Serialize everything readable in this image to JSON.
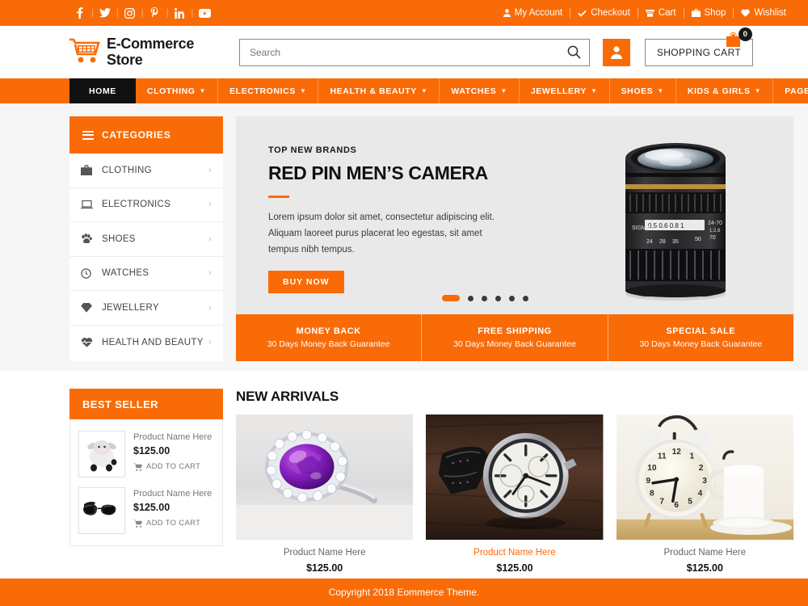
{
  "topbar": {
    "social": [
      {
        "name": "facebook-icon",
        "label": "Facebook"
      },
      {
        "name": "twitter-icon",
        "label": "Twitter"
      },
      {
        "name": "instagram-icon",
        "label": "Instagram"
      },
      {
        "name": "pinterest-icon",
        "label": "Pinterest"
      },
      {
        "name": "linkedin-icon",
        "label": "LinkedIn"
      },
      {
        "name": "youtube-icon",
        "label": "YouTube"
      }
    ],
    "links": [
      {
        "label": "My Account",
        "icon": "user-icon"
      },
      {
        "label": "Checkout",
        "icon": "check-icon"
      },
      {
        "label": "Cart",
        "icon": "cart-icon"
      },
      {
        "label": "Shop",
        "icon": "bag-icon"
      },
      {
        "label": "Wishlist",
        "icon": "heart-icon"
      }
    ]
  },
  "header": {
    "logo_line1": "E-Commerce",
    "logo_line2": "Store",
    "search_placeholder": "Search",
    "search_value": "",
    "cart_label": "SHOPPING CART",
    "cart_count": "0"
  },
  "nav": [
    {
      "label": "HOME",
      "caret": false,
      "active": true
    },
    {
      "label": "CLOTHING",
      "caret": true,
      "active": false
    },
    {
      "label": "ELECTRONICS",
      "caret": true,
      "active": false
    },
    {
      "label": "HEALTH & BEAUTY",
      "caret": true,
      "active": false
    },
    {
      "label": "WATCHES",
      "caret": true,
      "active": false
    },
    {
      "label": "JEWELLERY",
      "caret": true,
      "active": false
    },
    {
      "label": "SHOES",
      "caret": true,
      "active": false
    },
    {
      "label": "KIDS & GIRLS",
      "caret": true,
      "active": false
    },
    {
      "label": "PAGES",
      "caret": true,
      "active": false
    }
  ],
  "categories": {
    "title": "CATEGORIES",
    "items": [
      {
        "label": "CLOTHING",
        "icon": "bag-icon"
      },
      {
        "label": "ELECTRONICS",
        "icon": "laptop-icon"
      },
      {
        "label": "SHOES",
        "icon": "paw-icon"
      },
      {
        "label": "WATCHES",
        "icon": "clock-icon"
      },
      {
        "label": "JEWELLERY",
        "icon": "gem-icon"
      },
      {
        "label": "HEALTH AND BEAUTY",
        "icon": "heart-pulse-icon"
      }
    ]
  },
  "hero": {
    "kicker": "TOP NEW BRANDS",
    "title": "RED PIN MEN’S CAMERA",
    "description": "Lorem ipsum dolor sit amet, consectetur adipiscing elit. Aliquam laoreet purus placerat leo egestas, sit amet tempus nibh tempus.",
    "button": "BUY NOW",
    "image_alt": "camera-lens",
    "slides_total": 6,
    "slide_active": 1
  },
  "features": [
    {
      "title": "MONEY BACK",
      "subtitle": "30 Days Money Back Guarantee"
    },
    {
      "title": "FREE SHIPPING",
      "subtitle": "30 Days Money Back Guarantee"
    },
    {
      "title": "SPECIAL SALE",
      "subtitle": "30 Days Money Back Guarantee"
    }
  ],
  "best_seller": {
    "title": "BEST SELLER",
    "items": [
      {
        "name": "Product Name Here",
        "price": "$125.00",
        "cart_label": "ADD TO CART",
        "image_alt": "plush-lamb-toy"
      },
      {
        "name": "Product Name Here",
        "price": "$125.00",
        "cart_label": "ADD TO CART",
        "image_alt": "black-sunglasses"
      }
    ]
  },
  "new_arrivals": {
    "title": "NEW ARRIVALS",
    "items": [
      {
        "name": "Product Name Here",
        "price": "$125.00",
        "highlight": false,
        "image_alt": "amethyst-ring"
      },
      {
        "name": "Product Name Here",
        "price": "$125.00",
        "highlight": true,
        "image_alt": "chronograph-watch"
      },
      {
        "name": "Product Name Here",
        "price": "$125.00",
        "highlight": false,
        "image_alt": "alarm-clock-and-mug"
      }
    ]
  },
  "footer": {
    "copyright": "Copyright 2018 Eommerce Theme."
  },
  "colors": {
    "brand": "#f96b07",
    "dark": "#111111",
    "page_bg": "#f6f6f6"
  }
}
